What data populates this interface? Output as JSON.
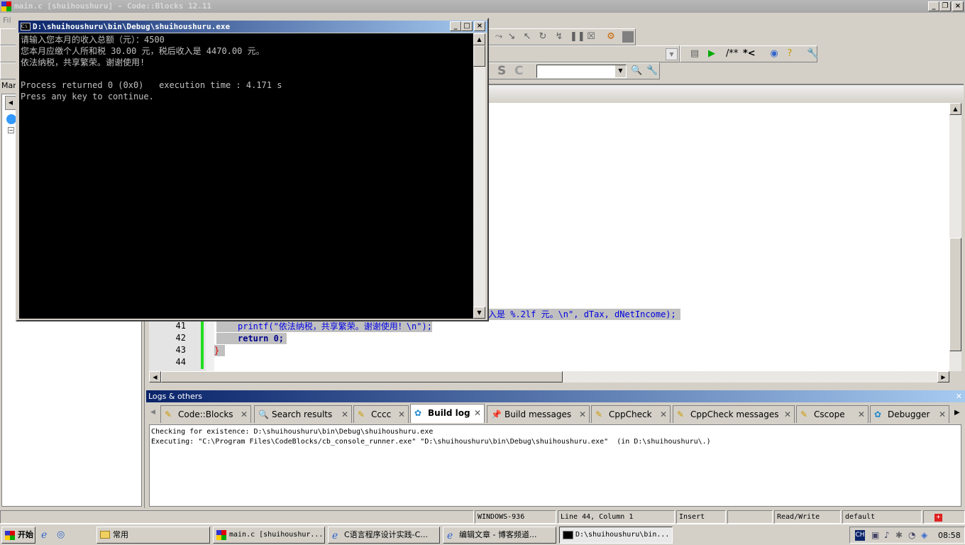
{
  "app": {
    "title": "main.c [shuihoushuru] - Code::Blocks 12.11",
    "menu_first": "Fil",
    "left_tab": "Mar"
  },
  "editor": {
    "lines": [
      {
        "num": "41",
        "text": "printf(\"依法纳税，共享繁荣。谢谢使用！\\n\");"
      },
      {
        "num": "42",
        "text": "return 0;"
      },
      {
        "num": "43",
        "text": "}"
      },
      {
        "num": "44",
        "text": ""
      }
    ],
    "line40_fragment": "入是 %.2lf 元。\\n\", dTax, dNetIncome);"
  },
  "logs": {
    "title": "Logs & others",
    "tabs": [
      {
        "label": "Code::Blocks",
        "icon": "pencil-icon"
      },
      {
        "label": "Search results",
        "icon": "magnifier-icon"
      },
      {
        "label": "Cccc",
        "icon": "pencil-icon"
      },
      {
        "label": "Build log",
        "icon": "gear-icon",
        "active": true
      },
      {
        "label": "Build messages",
        "icon": "pin-icon"
      },
      {
        "label": "CppCheck",
        "icon": "pencil-icon"
      },
      {
        "label": "CppCheck messages",
        "icon": "pencil-icon"
      },
      {
        "label": "Cscope",
        "icon": "pencil-icon"
      },
      {
        "label": "Debugger",
        "icon": "gear-icon"
      }
    ],
    "lines": [
      "Checking for existence: D:\\shuihoushuru\\bin\\Debug\\shuihoushuru.exe",
      "Executing: \"C:\\Program Files\\CodeBlocks/cb_console_runner.exe\" \"D:\\shuihoushuru\\bin\\Debug\\shuihoushuru.exe\"  (in D:\\shuihoushuru\\.)"
    ]
  },
  "status": {
    "encoding": "WINDOWS-936",
    "position": "Line 44, Column 1",
    "mode": "Insert",
    "access": "Read/Write",
    "lang": "default"
  },
  "console": {
    "title": "D:\\shuihoushuru\\bin\\Debug\\shuihoushuru.exe",
    "output": "请输入您本月的收入总额（元）：4500\n您本月应缴个人所和税 30.00 元，税后收入是 4470.00 元。\n依法纳税，共享繁荣。谢谢使用!\n\nProcess returned 0 (0x0)   execution time : 4.171 s\nPress any key to continue."
  },
  "taskbar": {
    "start": "开始",
    "items": [
      {
        "label": "常用"
      },
      {
        "label": "main.c [shuihoushur..."
      },
      {
        "label": "C语言程序设计实践-C..."
      },
      {
        "label": "编辑文章 - 博客频道..."
      },
      {
        "label": "D:\\shuihoushuru\\bin...",
        "active": true
      }
    ],
    "ime": "CH",
    "clock": "08:58"
  },
  "toolbar": {
    "comment_label": "/**",
    "comment2_label": "*<",
    "s_label": "S",
    "c_label": "C"
  }
}
